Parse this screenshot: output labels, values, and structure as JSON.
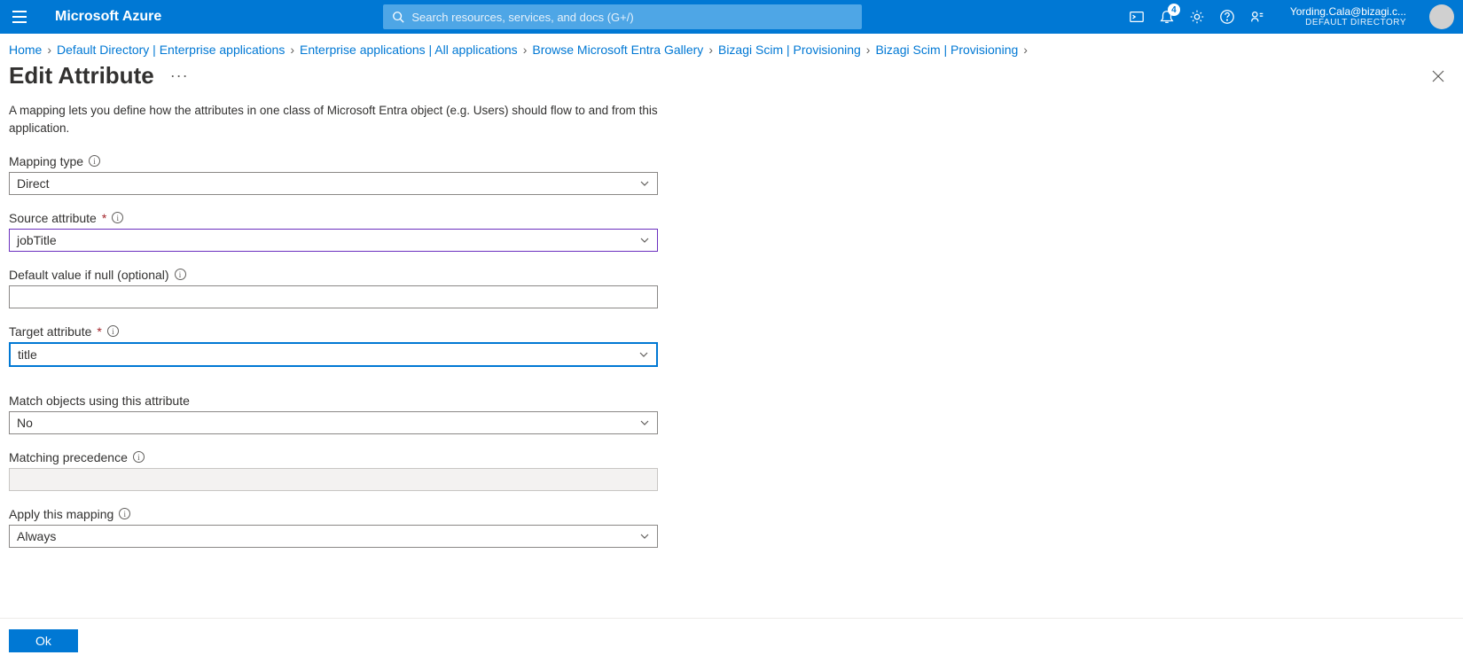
{
  "header": {
    "brand": "Microsoft Azure",
    "search_placeholder": "Search resources, services, and docs (G+/)",
    "notification_count": "4",
    "account_email": "Yording.Cala@bizagi.c...",
    "account_directory": "DEFAULT DIRECTORY"
  },
  "breadcrumb": {
    "items": [
      "Home",
      "Default Directory | Enterprise applications",
      "Enterprise applications | All applications",
      "Browse Microsoft Entra Gallery",
      "Bizagi Scim | Provisioning",
      "Bizagi Scim | Provisioning"
    ]
  },
  "page": {
    "title": "Edit Attribute",
    "more": "···",
    "description": "A mapping lets you define how the attributes in one class of Microsoft Entra object (e.g. Users) should flow to and from this application."
  },
  "form": {
    "mapping_type": {
      "label": "Mapping type",
      "value": "Direct"
    },
    "source_attribute": {
      "label": "Source attribute",
      "required": "*",
      "value": "jobTitle"
    },
    "default_value": {
      "label": "Default value if null (optional)",
      "value": ""
    },
    "target_attribute": {
      "label": "Target attribute",
      "required": "*",
      "value": "title"
    },
    "match_objects": {
      "label": "Match objects using this attribute",
      "value": "No"
    },
    "matching_precedence": {
      "label": "Matching precedence",
      "value": ""
    },
    "apply_mapping": {
      "label": "Apply this mapping",
      "value": "Always"
    }
  },
  "footer": {
    "ok_label": "Ok"
  }
}
